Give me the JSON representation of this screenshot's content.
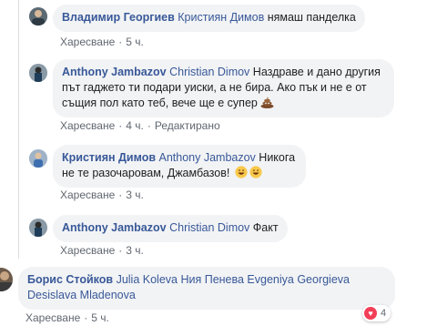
{
  "comments": [
    {
      "author": "Владимир Георгиев",
      "tag": "Кристиян Димов",
      "text": "нямаш панделка",
      "like": "Харесване",
      "time": "5 ч."
    },
    {
      "author": "Anthony Jambazov",
      "tag": "Christian Dimov",
      "text": "Наздраве и дано другия път гаджето ти подари уиски, а не бира. Ако пък и не е от същия пол като теб, вече ще е супер",
      "like": "Харесване",
      "time": "4 ч.",
      "edited": "Редактирано"
    },
    {
      "author": "Кристиян Димов",
      "tag": "Anthony Jambazov",
      "text": "Никога не те разочаровам, Джамбазов!",
      "like": "Харесване",
      "time": "3 ч."
    },
    {
      "author": "Anthony Jambazov",
      "tag": "Christian Dimov",
      "text": "Факт",
      "like": "Харесване",
      "time": "3 ч."
    },
    {
      "author": "Борис Стойков",
      "tags": "Julia Koleva Ния Пенева Evgeniya Georgieva Desislava Mladenova",
      "like": "Харесване",
      "time": "5 ч.",
      "reaction_count": "4"
    }
  ],
  "colors": {
    "link": "#385898",
    "bubble": "#f2f3f5",
    "meta": "#606770",
    "heart": "#f33e58"
  },
  "icons": {
    "poop": "poop-emoji",
    "laugh": "grinning-sweat-emoji",
    "heart": "love-reaction-icon"
  }
}
